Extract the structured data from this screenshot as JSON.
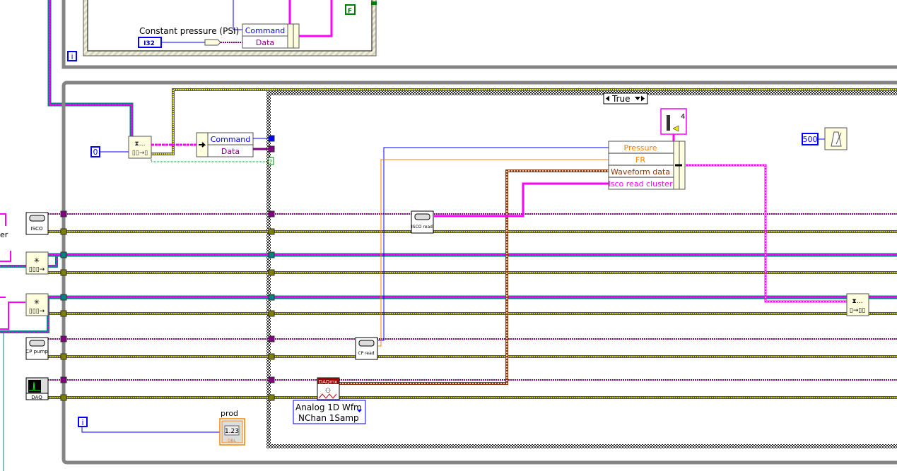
{
  "top_loop": {
    "control_label": "Constant pressure (PSI)",
    "control_type": "I32",
    "bundle_fields": [
      "Command",
      "Data"
    ],
    "stop_constant": "F",
    "iteration_terminal": "i"
  },
  "main_loop": {
    "constant_zero": "0",
    "bundle_fields": [
      "Command",
      "Data"
    ],
    "unknown_terminal": "?",
    "iteration_terminal": "i",
    "resources": [
      {
        "name": "isco-resource",
        "label": "ISCO"
      },
      {
        "name": "cp-pump-resource",
        "label": "CP pump"
      },
      {
        "name": "daq-resource",
        "label": "DAQ"
      }
    ],
    "left_fragment_text": "er",
    "indicator": {
      "label": "prod",
      "value": "1.23",
      "type": "DBL"
    }
  },
  "case_structure": {
    "selector_value": "True",
    "bundle_fields": [
      {
        "label": "Pressure",
        "color": "#ff8000"
      },
      {
        "label": "FR",
        "color": "#ff8000"
      },
      {
        "label": "Waveform data",
        "color": "#8b3a0f"
      },
      {
        "label": "Isco read cluster",
        "color": "#ff00ff"
      }
    ],
    "isco_read_label": "ISCO read",
    "cp_read_label": "CP read",
    "daqmx_label": "DAQmx",
    "daqmx_mode": [
      "Analog 1D Wfm",
      "NChan 1Samp"
    ],
    "array_index": "4",
    "wait_ms": "500"
  },
  "colors": {
    "loop_frame": "#848484",
    "cluster_wire": "#ff00ff",
    "refnum_wire": "#008080",
    "error_wire": "#c8c800",
    "visa_wire": "#800080",
    "numeric_i32": "#0000ff",
    "numeric_dbl": "#ff8000",
    "node_fill": "#ffffe0"
  }
}
